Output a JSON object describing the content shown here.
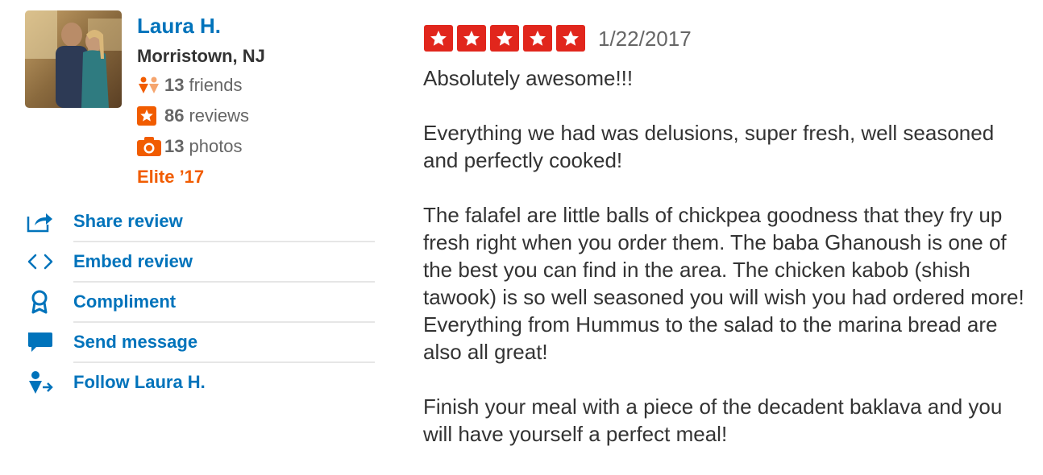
{
  "user": {
    "name": "Laura H.",
    "location": "Morristown, NJ",
    "friends_count": "13",
    "friends_label": "friends",
    "reviews_count": "86",
    "reviews_label": "reviews",
    "photos_count": "13",
    "photos_label": "photos",
    "elite": "Elite ’17"
  },
  "actions": [
    {
      "label": "Share review",
      "icon": "share-icon"
    },
    {
      "label": "Embed review",
      "icon": "embed-icon"
    },
    {
      "label": "Compliment",
      "icon": "ribbon-icon"
    },
    {
      "label": "Send message",
      "icon": "speech-bubble-icon"
    },
    {
      "label": "Follow Laura H.",
      "icon": "follow-user-icon"
    }
  ],
  "review": {
    "rating": 5,
    "max_rating": 5,
    "date": "1/22/2017",
    "paragraphs": [
      "Absolutely awesome!!!",
      "Everything we had was delusions, super fresh, well seasoned and perfectly cooked!",
      "The falafel are little balls of chickpea goodness that they fry up fresh right when you order them. The baba Ghanoush is one of the best you can find in the area. The chicken kabob (shish tawook) is so well seasoned you will wish you had ordered more! Everything from Hummus to the salad to the marina bread are also all great!",
      "Finish your meal with a piece of the decadent baklava and you will have yourself a perfect meal!"
    ]
  },
  "colors": {
    "link_blue": "#0073bb",
    "elite_orange": "#f15c00",
    "star_red": "#e1261c",
    "text_dark": "#333333",
    "text_gray": "#666666"
  }
}
